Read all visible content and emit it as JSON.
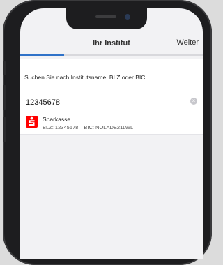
{
  "nav": {
    "title": "Ihr Institut",
    "next": "Weiter",
    "progress_fraction": 0.24
  },
  "prompt": "Suchen Sie nach Institutsname, BLZ oder BIC",
  "search": {
    "value": "12345678",
    "clear_glyph": "×"
  },
  "results": [
    {
      "name": "Sparkasse",
      "blz": "BLZ: 12345678",
      "bic": "BIC: NOLADE21LWL",
      "logo_icon": "sparkasse-logo-icon",
      "logo_color": "#ff0000"
    }
  ],
  "colors": {
    "accent": "#2f72c8",
    "background": "#f2f2f4"
  }
}
